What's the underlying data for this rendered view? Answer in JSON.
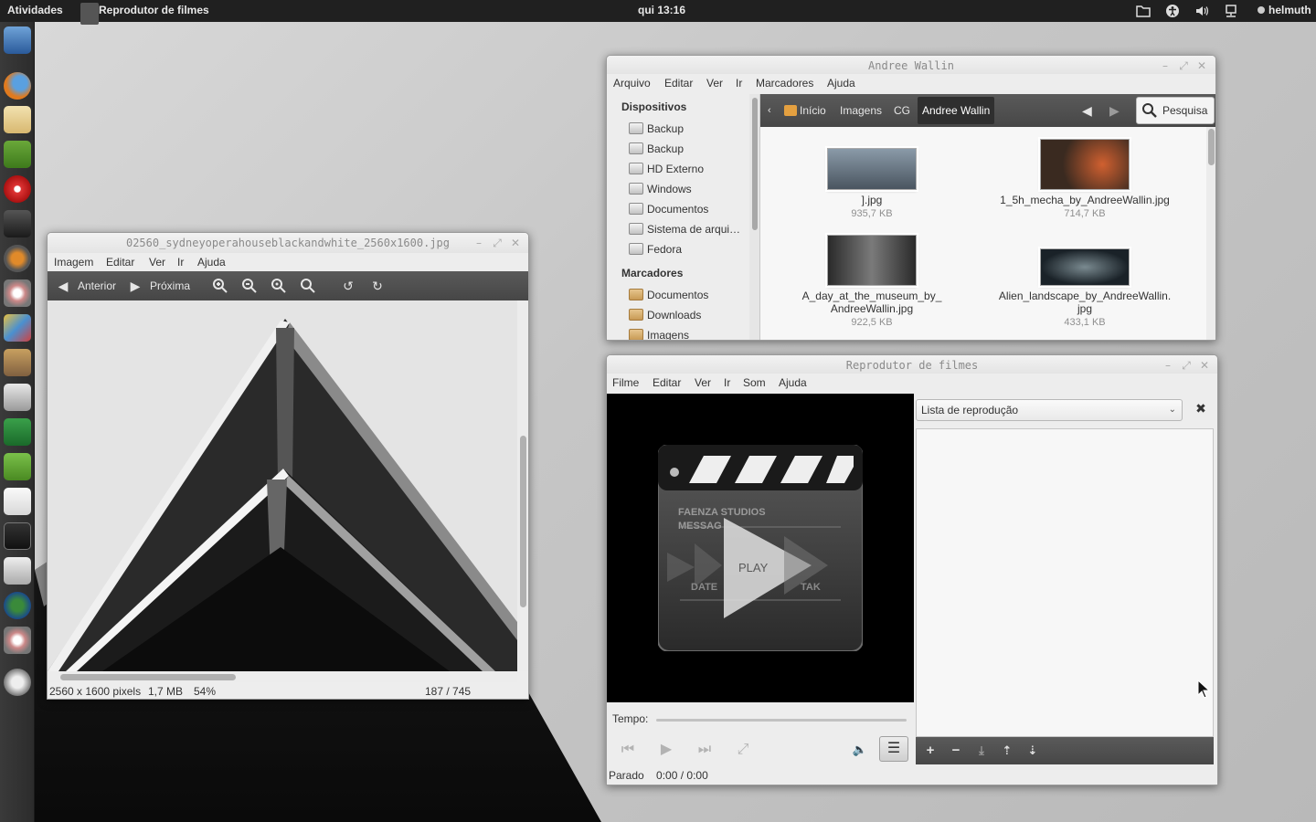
{
  "topbar": {
    "activities": "Atividades",
    "app_name": "Reprodutor de filmes",
    "clock": "qui 13:16",
    "user": "helmuth",
    "tray_icons": [
      "folder-icon",
      "accessibility-icon",
      "volume-icon",
      "network-icon"
    ]
  },
  "dock": {
    "items": [
      "monitor-icon",
      "firefox-icon",
      "mail-icon",
      "xchat-icon",
      "cd-burner-icon",
      "video-icon",
      "audio-icon",
      "eye-of-gnome-icon",
      "paint-icon",
      "gimp-icon",
      "calculator-icon",
      "vim-icon",
      "qt-icon",
      "text-editor-icon",
      "terminal-icon",
      "file-manager-icon",
      "globe-icon",
      "viewer-icon",
      "settings-icon"
    ]
  },
  "viewer": {
    "title": "02560_sydneyoperahouseblackandwhite_2560x1600.jpg",
    "menu": [
      "Imagem",
      "Editar",
      "Ver",
      "Ir",
      "Ajuda"
    ],
    "prev_label": "Anterior",
    "next_label": "Próxima",
    "status_dims": "2560 x 1600 pixels",
    "status_size": "1,7 MB",
    "status_zoom": "54%",
    "status_index": "187 / 745"
  },
  "files": {
    "title": "Andree Wallin",
    "menu": [
      "Arquivo",
      "Editar",
      "Ver",
      "Ir",
      "Marcadores",
      "Ajuda"
    ],
    "devices_header": "Dispositivos",
    "devices": [
      {
        "label": "Backup",
        "eject": true
      },
      {
        "label": "Backup",
        "eject": true
      },
      {
        "label": "HD Externo",
        "eject": true
      },
      {
        "label": "Windows",
        "eject": false
      },
      {
        "label": "Documentos",
        "eject": true
      },
      {
        "label": "Sistema de arqui…",
        "eject": false
      },
      {
        "label": "Fedora",
        "eject": true
      }
    ],
    "bookmarks_header": "Marcadores",
    "bookmarks": [
      "Documentos",
      "Downloads",
      "Imagens"
    ],
    "path": [
      "Início",
      "Imagens",
      "CG",
      "Andree Wallin"
    ],
    "search_label": "Pesquisa",
    "items": [
      {
        "name": "].jpg",
        "size": "935,7 KB"
      },
      {
        "name": "1_5h_mecha_by_AndreeWallin.jpg",
        "size": "714,7 KB"
      },
      {
        "name_line1": "A_day_at_the_museum_by_",
        "name_line2": "AndreeWallin.jpg",
        "size": "922,5 KB"
      },
      {
        "name_line1": "Alien_landscape_by_AndreeWallin.",
        "name_line2": "jpg",
        "size": "433,1 KB"
      }
    ]
  },
  "player": {
    "title": "Reprodutor de filmes",
    "menu": [
      "Filme",
      "Editar",
      "Ver",
      "Ir",
      "Som",
      "Ajuda"
    ],
    "playlist_selected": "Lista de reprodução",
    "video_text_1": "FAENZA STUDIOS",
    "video_text_2": "MESSAG",
    "video_text_3": "DATE",
    "video_text_4": "TAK",
    "play_label": "PLAY",
    "time_label": "Tempo:",
    "status": "Parado",
    "position": "0:00 / 0:00"
  }
}
